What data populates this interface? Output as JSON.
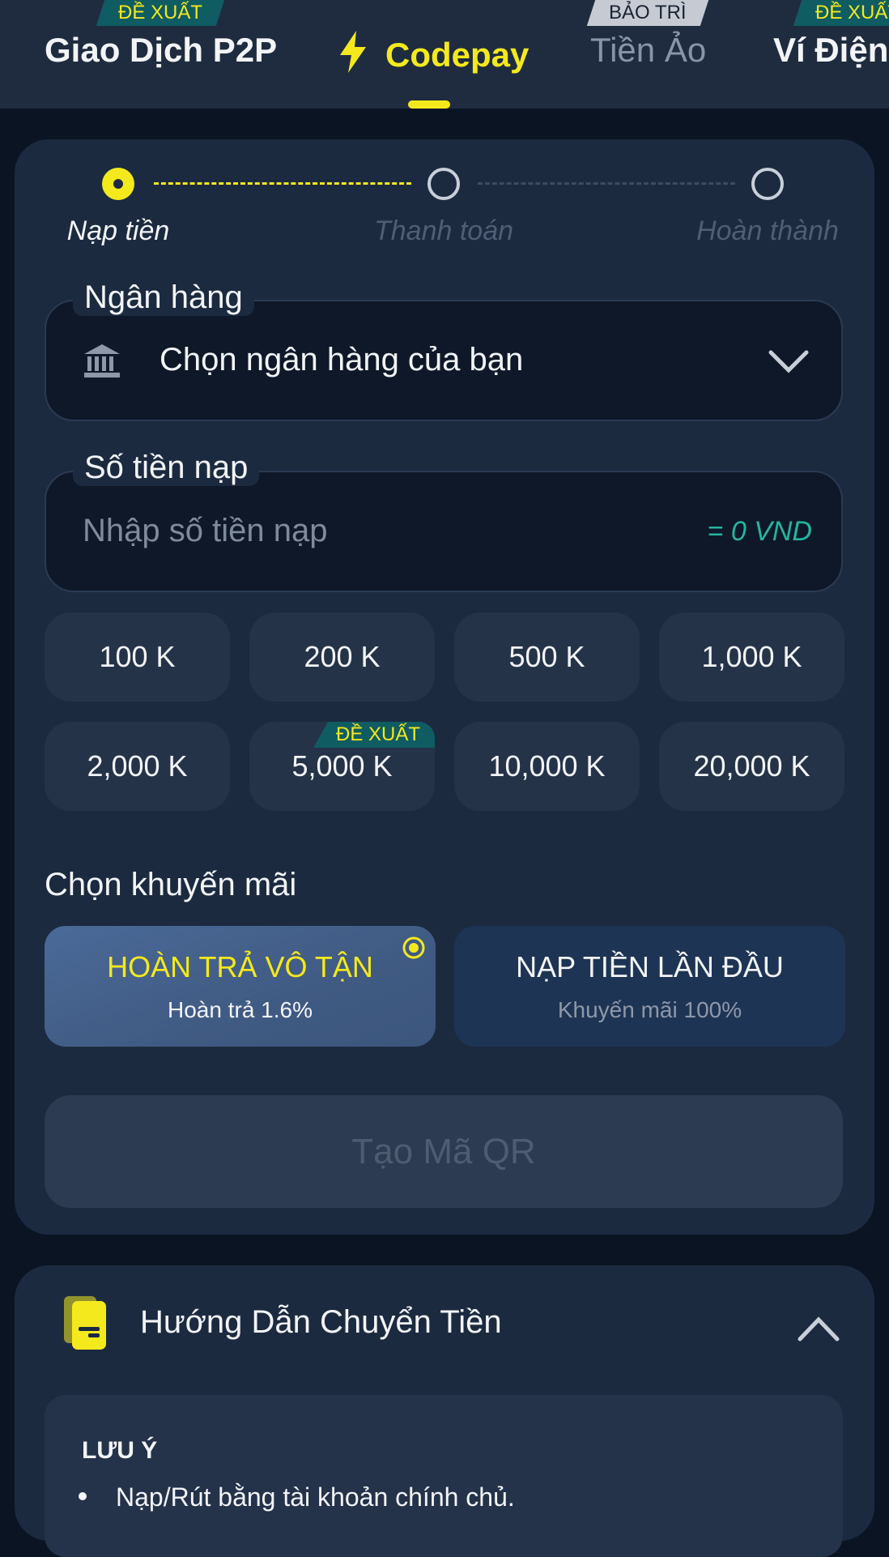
{
  "tabs": [
    {
      "label": "Giao Dịch P2P",
      "badge": "ĐỀ XUẤT"
    },
    {
      "label": "Codepay",
      "badge": ""
    },
    {
      "label": "Tiền Ảo",
      "badge": "BẢO TRÌ"
    },
    {
      "label": "Ví Điện",
      "badge": "ĐỀ XUẤT"
    }
  ],
  "stepper": {
    "steps": [
      "Nạp tiền",
      "Thanh toán",
      "Hoàn thành"
    ]
  },
  "bank": {
    "label": "Ngân hàng",
    "placeholder": "Chọn ngân hàng của bạn"
  },
  "amount": {
    "label": "Số tiền nạp",
    "placeholder": "Nhập số tiền nạp",
    "converted": "= 0 VND"
  },
  "quick_amounts": [
    {
      "label": "100 K"
    },
    {
      "label": "200 K"
    },
    {
      "label": "500 K"
    },
    {
      "label": "1,000 K"
    },
    {
      "label": "2,000 K"
    },
    {
      "label": "5,000 K",
      "badge": "ĐỀ XUẤT"
    },
    {
      "label": "10,000 K"
    },
    {
      "label": "20,000 K"
    }
  ],
  "promo": {
    "heading": "Chọn khuyến mãi",
    "options": [
      {
        "title": "HOÀN TRẢ VÔ TẬN",
        "subtitle": "Hoàn trả 1.6%"
      },
      {
        "title": "NẠP TIỀN LẦN ĐẦU",
        "subtitle": "Khuyến mãi 100%"
      }
    ]
  },
  "submit": {
    "label": "Tạo Mã QR"
  },
  "guide": {
    "title": "Hướng Dẫn Chuyển Tiền",
    "note_heading": "LƯU Ý",
    "note_item": "Nạp/Rút bằng tài khoản chính chủ."
  },
  "colors": {
    "accent": "#f4e91c",
    "teal": "#23b5a0",
    "card": "#1c2a40"
  }
}
